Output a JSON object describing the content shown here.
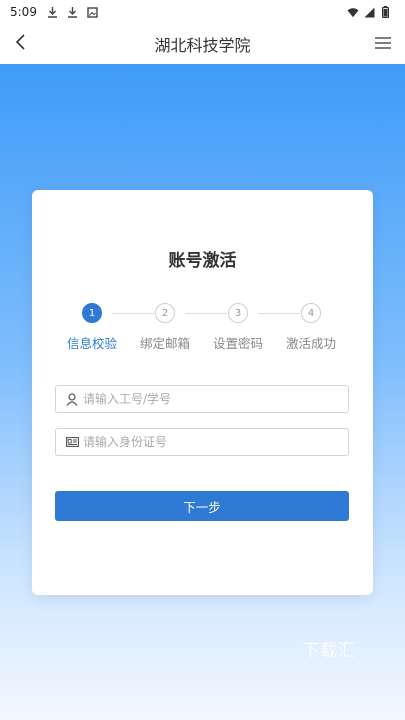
{
  "status_bar": {
    "time": "5:09",
    "left_icons": [
      "download-icon",
      "download-icon",
      "image-icon"
    ],
    "right_icons": [
      "wifi-icon",
      "signal-icon",
      "battery-icon"
    ]
  },
  "header": {
    "title": "湖北科技学院",
    "back_icon": "chevron-left-icon",
    "menu_icon": "hamburger-menu-icon"
  },
  "card": {
    "title": "账号激活",
    "steps": [
      {
        "number": "1",
        "label": "信息校验",
        "active": true
      },
      {
        "number": "2",
        "label": "绑定邮箱",
        "active": false
      },
      {
        "number": "3",
        "label": "设置密码",
        "active": false
      },
      {
        "number": "4",
        "label": "激活成功",
        "active": false
      }
    ],
    "id_field": {
      "placeholder": "请输入工号/学号",
      "value": "",
      "icon": "user-icon"
    },
    "idcard_field": {
      "placeholder": "请输入身份证号",
      "value": "",
      "icon": "id-card-icon"
    },
    "next_button_label": "下一步"
  },
  "watermark": "下载汇",
  "colors": {
    "accent": "#2e7ad5",
    "background_top": "#3f9cf8",
    "background_bottom": "#f3f8ff"
  }
}
